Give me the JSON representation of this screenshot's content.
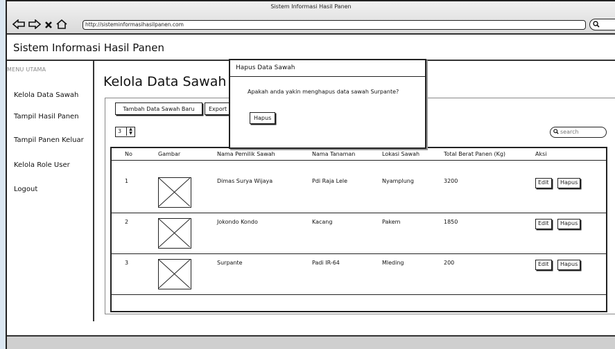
{
  "window": {
    "title": "Sistem Informasi Hasil Panen",
    "url": "http://sisteminformasihasilpanen.com"
  },
  "app": {
    "title": "Sistem Informasi Hasil Panen"
  },
  "sidebar": {
    "heading": "MENU UTAMA",
    "items": [
      {
        "label": "Kelola Data Sawah"
      },
      {
        "label": "Tampil Hasil Panen"
      },
      {
        "label": "Tampil Panen Keluar"
      },
      {
        "label": "Kelola Role User"
      },
      {
        "label": "Logout"
      }
    ]
  },
  "main": {
    "title": "Kelola Data Sawah",
    "add_button": "Tambah Data Sawah Baru",
    "export_button": "Export D",
    "page_size": "3",
    "search_placeholder": "search",
    "table": {
      "headers": [
        "No",
        "Gambar",
        "Nama Pemilik Sawah",
        "Nama Tanaman",
        "Lokasi Sawah",
        "Total Berat Panen (Kg)",
        "Aksi"
      ],
      "rows": [
        {
          "no": "1",
          "owner": "Dimas Surya Wijaya",
          "crop": "Pdi Raja Lele",
          "location": "Nyamplung",
          "weight": "3200",
          "edit": "Edit",
          "delete": "Hapus"
        },
        {
          "no": "2",
          "owner": "Jokondo Kondo",
          "crop": "Kacang",
          "location": "Pakem",
          "weight": "1850",
          "edit": "Edit",
          "delete": "Hapus"
        },
        {
          "no": "3",
          "owner": "Surpante",
          "crop": "Padi IR-64",
          "location": "Mleding",
          "weight": "200",
          "edit": "Edit",
          "delete": "Hapus"
        }
      ]
    }
  },
  "modal": {
    "title": "Hapus Data Sawah",
    "message": "Apakah anda yakin menghapus data sawah Surpante?",
    "confirm_button": "Hapus"
  },
  "icons": {
    "back": "arrow-left-icon",
    "forward": "arrow-right-icon",
    "close": "close-icon",
    "home": "home-icon",
    "search": "search-icon"
  }
}
